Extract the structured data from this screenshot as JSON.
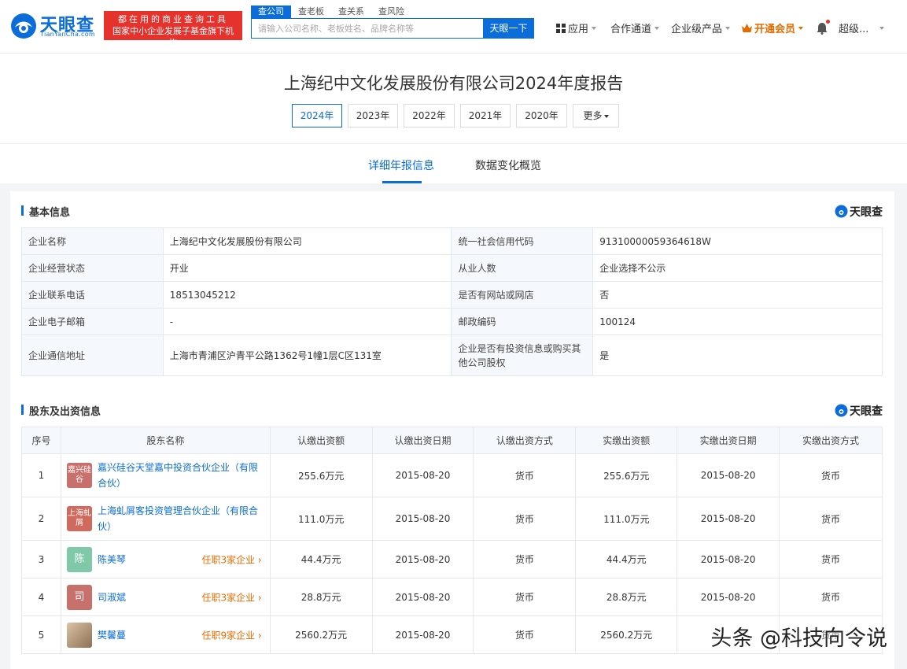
{
  "header": {
    "brand": "天眼查",
    "brand_sub": "TianYanCha.com",
    "slogan_line1": "都在用的商业查询工具",
    "slogan_line2": "国家中小企业发展子基金旗下机构",
    "search_tabs": [
      "查公司",
      "查老板",
      "查关系",
      "查风险"
    ],
    "search_placeholder": "请输入公司名称、老板姓名、品牌名称等",
    "search_button": "天眼一下",
    "nav": [
      "应用",
      "合作通道",
      "企业级产品",
      "开通会员",
      "超级..."
    ]
  },
  "report": {
    "title": "上海纪中文化发展股份有限公司2024年度报告",
    "years": [
      "2024年",
      "2023年",
      "2022年",
      "2021年",
      "2020年",
      "更多"
    ],
    "tabs": [
      "详细年报信息",
      "数据变化概览"
    ]
  },
  "basic": {
    "section_title": "基本信息",
    "watermark": "天眼查",
    "rows": [
      {
        "k1": "企业名称",
        "v1": "上海纪中文化发展股份有限公司",
        "k2": "统一社会信用代码",
        "v2": "91310000059364618W"
      },
      {
        "k1": "企业经营状态",
        "v1": "开业",
        "k2": "从业人数",
        "v2": "企业选择不公示"
      },
      {
        "k1": "企业联系电话",
        "v1": "18513045212",
        "k2": "是否有网站或网店",
        "v2": "否"
      },
      {
        "k1": "企业电子邮箱",
        "v1": "-",
        "k2": "邮政编码",
        "v2": "100124"
      },
      {
        "k1": "企业通信地址",
        "v1": "上海市青浦区沪青平公路1362号1幢1层C区131室",
        "k2": "企业是否有投资信息或购买其他公司股权",
        "v2": "是"
      }
    ]
  },
  "shareholders": {
    "section_title": "股东及出资信息",
    "watermark": "天眼查",
    "columns": [
      "序号",
      "股东名称",
      "认缴出资额",
      "认缴出资日期",
      "认缴出资方式",
      "实缴出资额",
      "实缴出资日期",
      "实缴出资方式"
    ],
    "rows": [
      {
        "no": "1",
        "avatar": "嘉兴硅谷",
        "avatar_color": "#c8706c",
        "name": "嘉兴硅谷天堂嘉中投资合伙企业（有限合伙）",
        "tag": "",
        "sub_amt": "255.6万元",
        "sub_date": "2015-08-20",
        "sub_way": "货币",
        "paid_amt": "255.6万元",
        "paid_date": "2015-08-20",
        "paid_way": "货币"
      },
      {
        "no": "2",
        "avatar": "上海虬屑",
        "avatar_color": "#d06a5e",
        "name": "上海虬屑客投资管理合伙企业（有限合伙）",
        "tag": "",
        "sub_amt": "111.0万元",
        "sub_date": "2015-08-20",
        "sub_way": "货币",
        "paid_amt": "111.0万元",
        "paid_date": "2015-08-20",
        "paid_way": "货币"
      },
      {
        "no": "3",
        "avatar": "陈",
        "avatar_color": "#7fc9a8",
        "name": "陈美琴",
        "tag": "任职3家企业 ›",
        "sub_amt": "44.4万元",
        "sub_date": "2015-08-20",
        "sub_way": "货币",
        "paid_amt": "44.4万元",
        "paid_date": "2015-08-20",
        "paid_way": "货币"
      },
      {
        "no": "4",
        "avatar": "司",
        "avatar_color": "#c8706c",
        "name": "司淑斌",
        "tag": "任职3家企业 ›",
        "sub_amt": "28.8万元",
        "sub_date": "2015-08-20",
        "sub_way": "货币",
        "paid_amt": "28.8万元",
        "paid_date": "2015-08-20",
        "paid_way": "货币"
      },
      {
        "no": "5",
        "avatar": "",
        "avatar_color": "#b89a7a",
        "name": "樊馨蔓",
        "tag": "任职9家企业 ›",
        "sub_amt": "2560.2万元",
        "sub_date": "2015-08-20",
        "sub_way": "货币",
        "paid_amt": "2560.2万元",
        "paid_date": "",
        "paid_way": "货币"
      }
    ]
  },
  "overlay_watermark": "头条 @科技向令说",
  "colors": {
    "brand_blue": "#0a6dd9",
    "slogan_red": "#e5322d",
    "vip_orange": "#e56b00"
  }
}
